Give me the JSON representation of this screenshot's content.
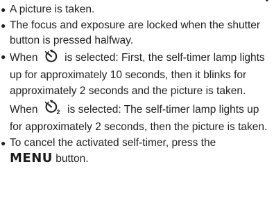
{
  "header_fragment": "y",
  "bullets": [
    {
      "text": "A picture is taken."
    },
    {
      "text": "The focus and exposure are locked when the shutter button is pressed halfway."
    },
    {
      "text_a_prefix": "When",
      "text_a_suffix": "is selected: First, the self-timer lamp lights up for approximately 10 seconds, then it blinks for approximately 2 seconds and the picture is taken.",
      "text_b_prefix": "When",
      "text_b_suffix": "is selected: The self-timer lamp lights up for approximately  2 seconds, then the picture is taken.",
      "icon_a": "self-timer-10s-icon",
      "icon_b": "self-timer-2s-icon",
      "icon_b_subscript": "2"
    },
    {
      "text_prefix": "To cancel the activated self-timer, press the",
      "menu_word": "MENU",
      "text_suffix": "button."
    }
  ],
  "bullet_glyph": "●"
}
